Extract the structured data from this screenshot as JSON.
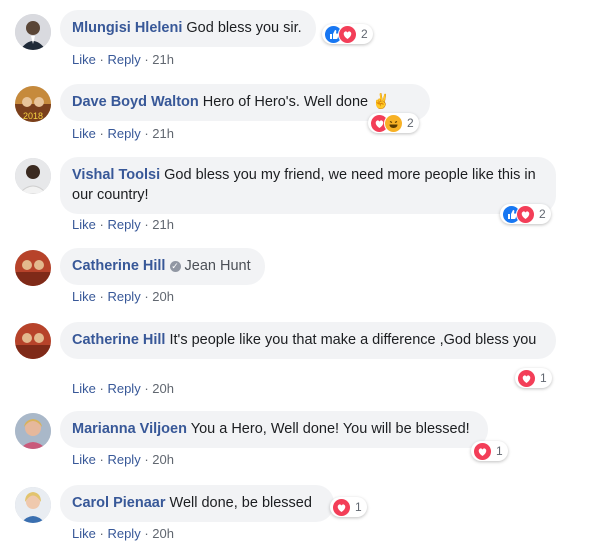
{
  "common": {
    "like": "Like",
    "reply": "Reply",
    "sep": "·"
  },
  "comments": [
    {
      "author": "Mlungisi Hleleni",
      "text": "God bless you sir.",
      "time": "21h",
      "reactions": [
        "like",
        "love"
      ],
      "count": "2"
    },
    {
      "author": "Dave Boyd Walton",
      "text": "Hero of Hero's. Well done ✌",
      "time": "21h",
      "reactions": [
        "love",
        "haha"
      ],
      "count": "2"
    },
    {
      "author": "Vishal Toolsi",
      "text": "God bless you my friend, we need more people like this in our country!",
      "time": "21h",
      "reactions": [
        "like",
        "love"
      ],
      "count": "2"
    },
    {
      "author": "Catherine Hill",
      "tagged": "Jean Hunt",
      "time": "20h"
    },
    {
      "author": "Catherine Hill",
      "text": "It's people like you that make a difference ,God bless you",
      "time": "20h",
      "reactions": [
        "love"
      ],
      "count": "1"
    },
    {
      "author": "Marianna Viljoen",
      "text": "You a Hero, Well done! You will be blessed!",
      "time": "20h",
      "reactions": [
        "love"
      ],
      "count": "1"
    },
    {
      "author": "Carol Pienaar",
      "text": "Well done, be blessed",
      "time": "20h",
      "reactions": [
        "love"
      ],
      "count": "1"
    }
  ],
  "colors": {
    "author": "#385898",
    "bubble": "#f2f3f5",
    "like": "#1877f2",
    "love": "#f33e58",
    "haha": "#f7b125"
  }
}
